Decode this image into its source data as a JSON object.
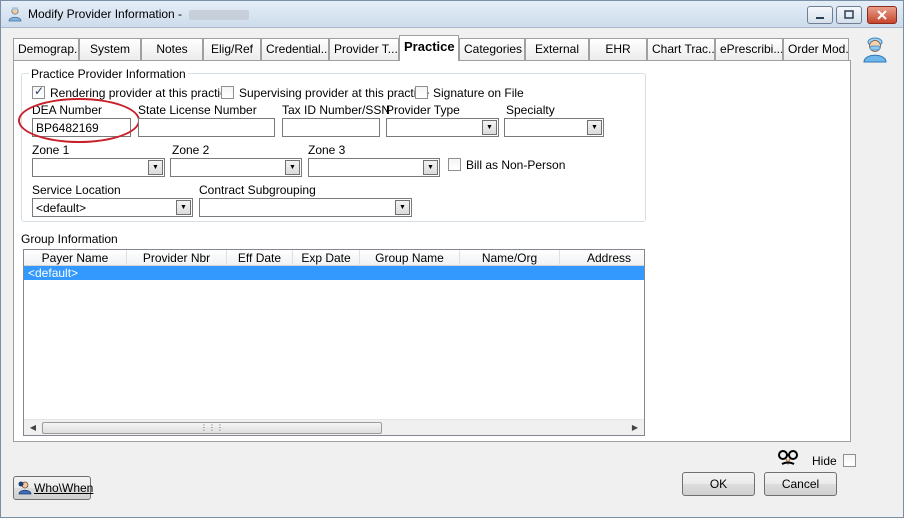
{
  "window": {
    "title": "Modify Provider Information -",
    "title_name": "[name redacted]"
  },
  "tabs": [
    {
      "label": "Demograp..."
    },
    {
      "label": "System"
    },
    {
      "label": "Notes"
    },
    {
      "label": "Elig/Ref"
    },
    {
      "label": "Credential..."
    },
    {
      "label": "Provider T..."
    },
    {
      "label": "Practice",
      "active": true
    },
    {
      "label": "Categories"
    },
    {
      "label": "External"
    },
    {
      "label": "EHR"
    },
    {
      "label": "Chart Trac..."
    },
    {
      "label": "ePrescribi..."
    },
    {
      "label": "Order Mod..."
    }
  ],
  "practice": {
    "group_title": "Practice Provider Information",
    "rendering_label": "Rendering provider at this practice",
    "rendering_checked": true,
    "supervising_label": "Supervising provider at this practice",
    "supervising_checked": false,
    "signature_label": "Signature on File",
    "signature_checked": false,
    "dea_label": "DEA Number",
    "dea_value": "BP6482169",
    "state_license_label": "State License Number",
    "state_license_value": "",
    "tax_id_label": "Tax ID Number/SSN",
    "tax_id_value": "",
    "provider_type_label": "Provider Type",
    "provider_type_value": "",
    "specialty_label": "Specialty",
    "specialty_value": "",
    "zone1_label": "Zone 1",
    "zone2_label": "Zone 2",
    "zone3_label": "Zone 3",
    "bill_nonperson_label": "Bill as Non-Person",
    "bill_nonperson_checked": false,
    "service_location_label": "Service Location",
    "service_location_value": "<default>",
    "contract_label": "Contract Subgrouping",
    "contract_value": ""
  },
  "group_info": {
    "title": "Group Information",
    "columns": [
      "Payer Name",
      "Provider Nbr",
      "Eff Date",
      "Exp Date",
      "Group Name",
      "Name/Org",
      "Address"
    ],
    "rows": [
      {
        "payer_name": "<default>"
      }
    ]
  },
  "footer": {
    "hide_label": "Hide",
    "hide_checked": false,
    "ok_label": "OK",
    "cancel_label": "Cancel",
    "whowhen_label": "Who\\When"
  },
  "colors": {
    "selection": "#3399ff",
    "annotation_circle": "#c8202a",
    "titlebar": "#dbe6f3"
  }
}
